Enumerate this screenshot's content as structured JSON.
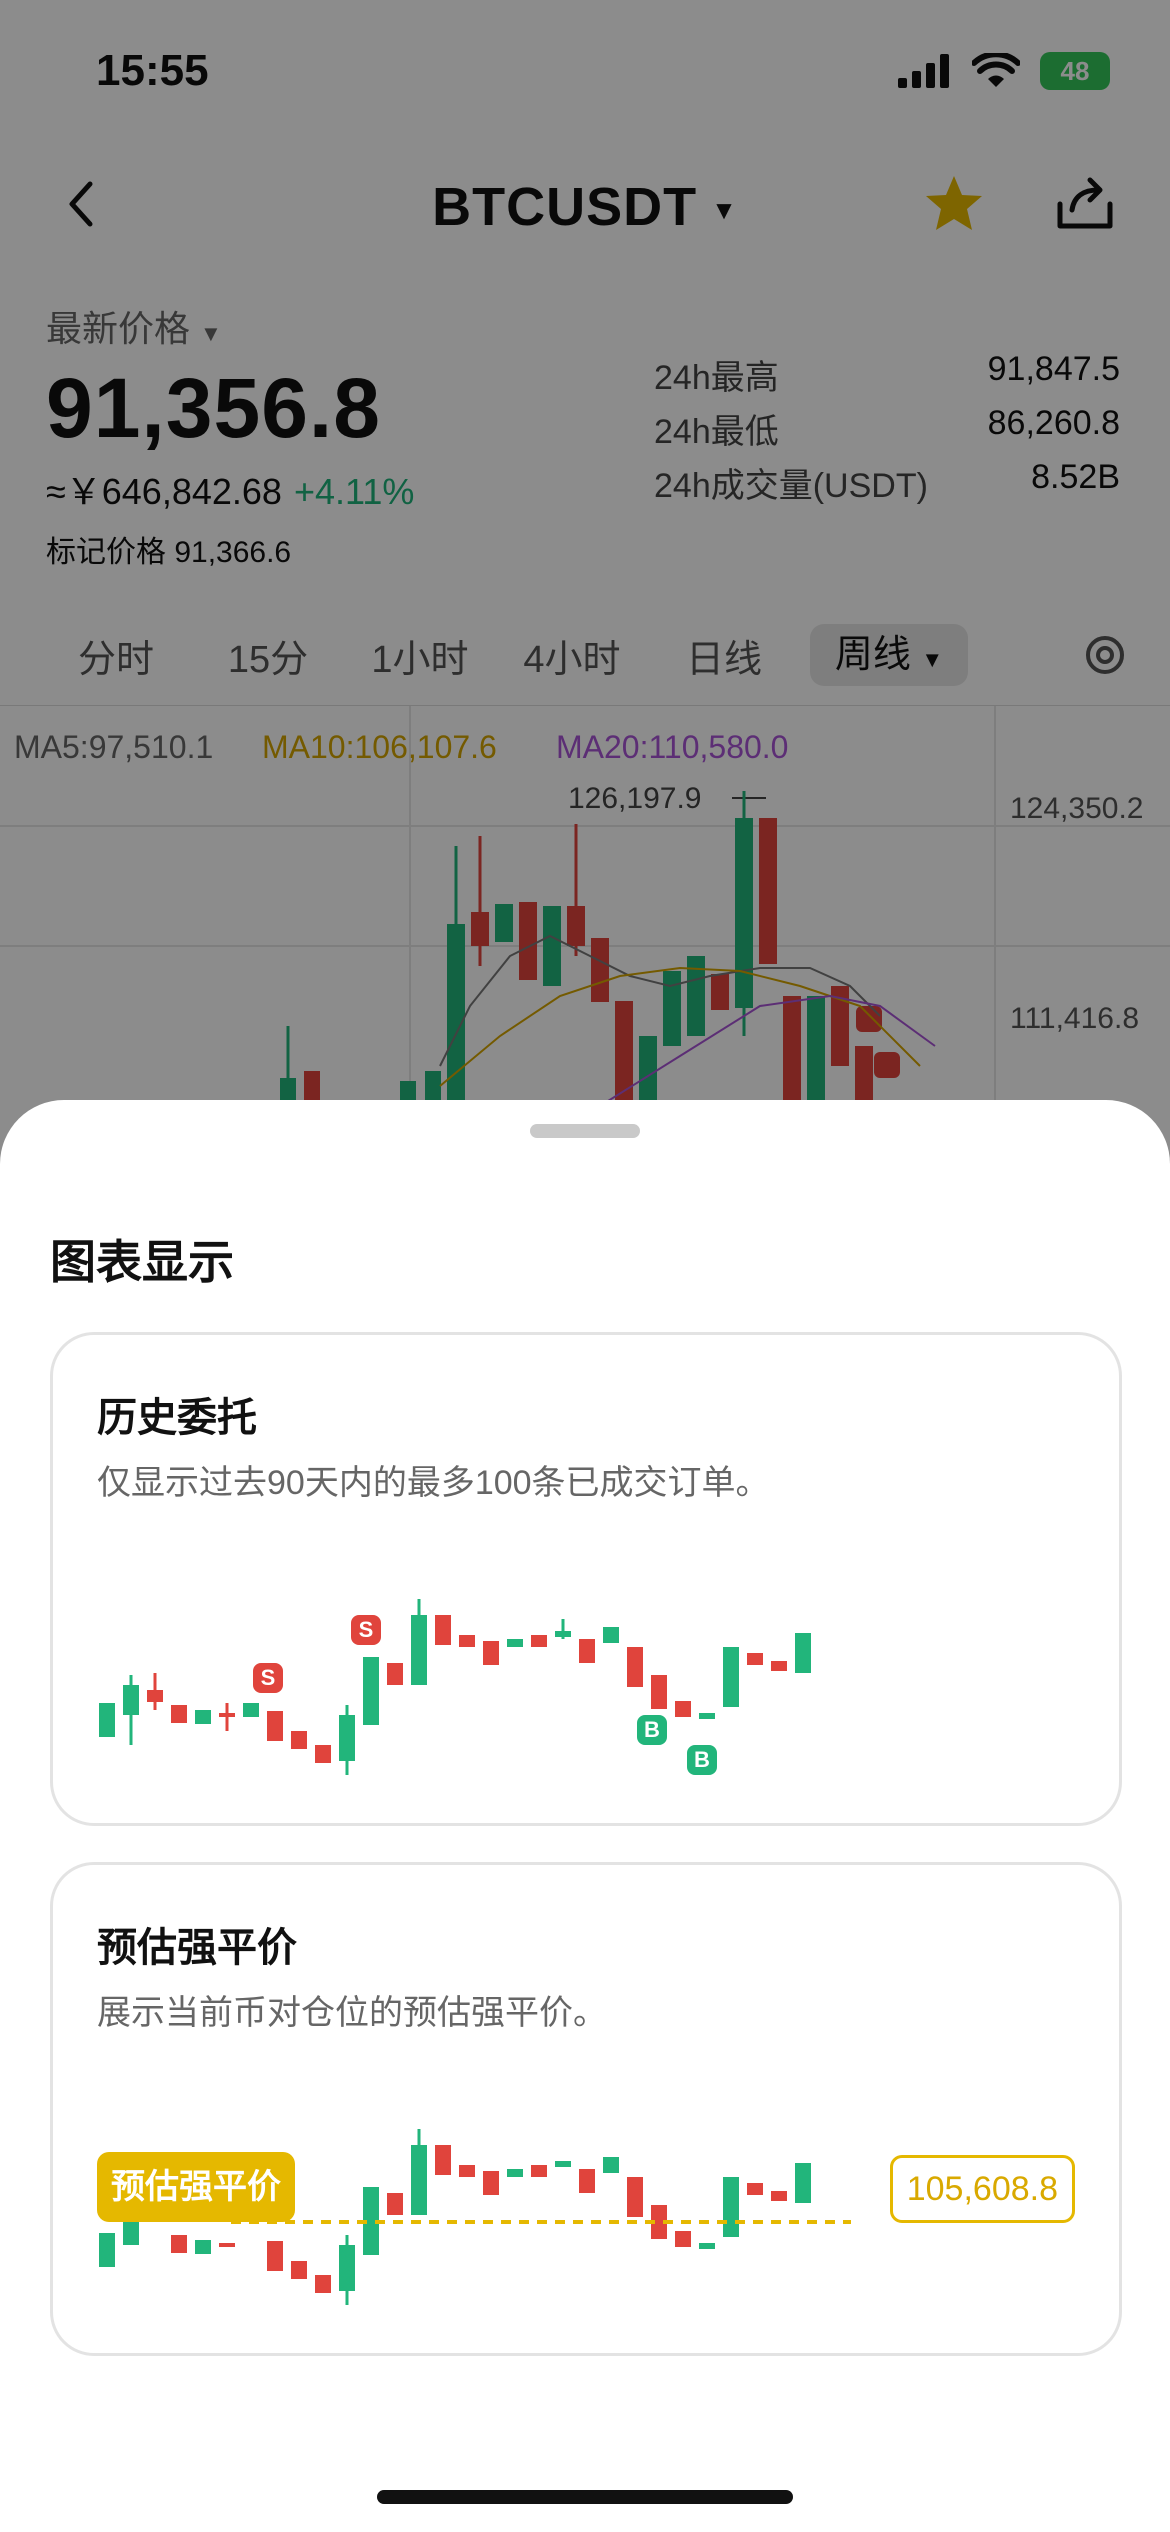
{
  "status_bar": {
    "time": "15:55",
    "battery": "48"
  },
  "header": {
    "pair": "BTCUSDT"
  },
  "price": {
    "latest_label": "最新价格",
    "last": "91,356.8",
    "cny": "≈￥646,842.68",
    "change": "+4.11%",
    "mark_label": "标记价格",
    "mark": "91,366.6"
  },
  "stats": [
    {
      "label": "24h最高",
      "value": "91,847.5"
    },
    {
      "label": "24h最低",
      "value": "86,260.8"
    },
    {
      "label": "24h成交量(USDT)",
      "value": "8.52B"
    }
  ],
  "timeframes": [
    "分时",
    "15分",
    "1小时",
    "4小时",
    "日线",
    "周线"
  ],
  "chart": {
    "ma5": "MA5:97,510.1",
    "ma10": "MA10:106,107.6",
    "ma20": "MA20:110,580.0",
    "high_label": "126,197.9",
    "axis_labels": [
      "124,350.2",
      "111,416.8"
    ],
    "colors": {
      "up": "#22b57b",
      "down": "#e0443c",
      "ma10": "#d4a400",
      "ma20": "#a855d6"
    }
  },
  "sheet": {
    "title": "图表显示",
    "cards": [
      {
        "title": "历史委托",
        "desc": "仅显示过去90天内的最多100条已成交订单。"
      },
      {
        "title": "预估强平价",
        "desc": "展示当前币对仓位的预估强平价。",
        "tag": "预估强平价",
        "value": "105,608.8"
      }
    ],
    "markers": {
      "sell": "S",
      "buy": "B"
    }
  },
  "colors": {
    "accent": "#e5b800",
    "up": "#22b57b",
    "down": "#e0443c"
  }
}
